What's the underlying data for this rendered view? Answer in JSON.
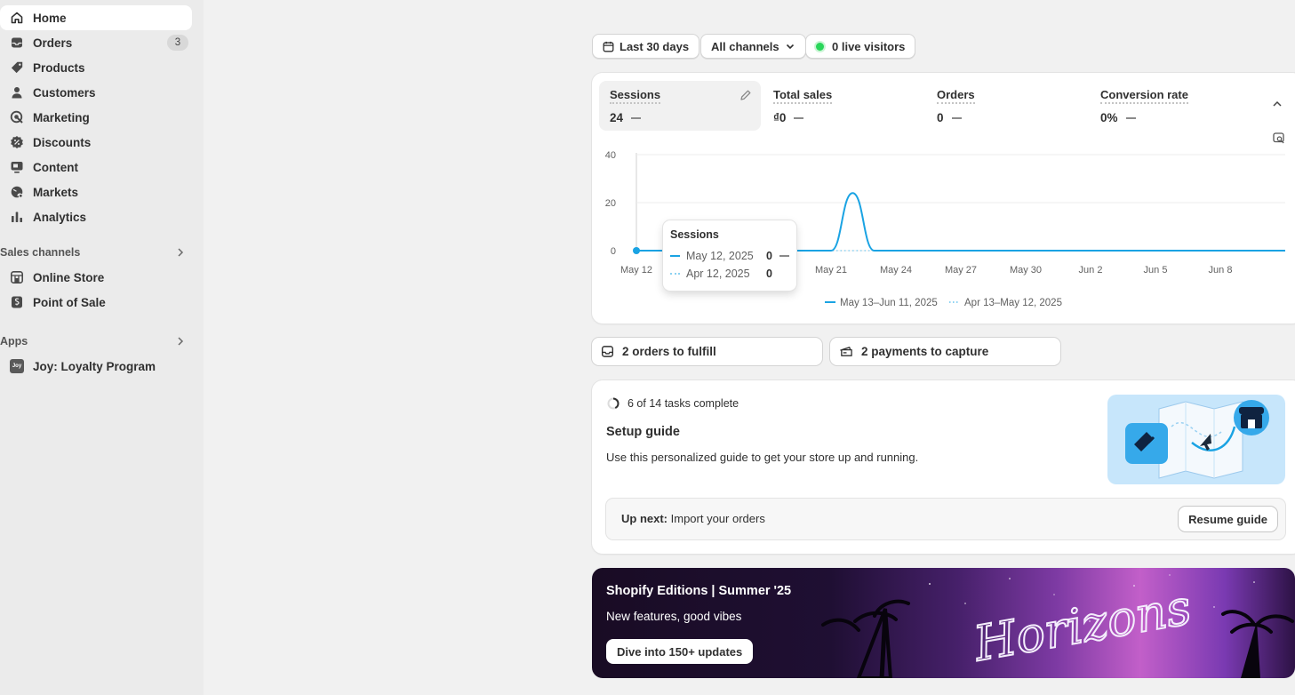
{
  "sidebar": {
    "items": [
      {
        "label": "Home",
        "icon": "home-icon"
      },
      {
        "label": "Orders",
        "icon": "orders-icon",
        "badge": "3"
      },
      {
        "label": "Products",
        "icon": "tag-icon"
      },
      {
        "label": "Customers",
        "icon": "person-icon"
      },
      {
        "label": "Marketing",
        "icon": "target-icon"
      },
      {
        "label": "Discounts",
        "icon": "discount-icon"
      },
      {
        "label": "Content",
        "icon": "content-icon"
      },
      {
        "label": "Markets",
        "icon": "globe-icon"
      },
      {
        "label": "Analytics",
        "icon": "bar-chart-icon"
      }
    ],
    "sales_channels_label": "Sales channels",
    "sales_channels": [
      {
        "label": "Online Store",
        "icon": "store-icon"
      },
      {
        "label": "Point of Sale",
        "icon": "pos-icon"
      }
    ],
    "apps_label": "Apps",
    "apps": [
      {
        "label": "Joy: Loyalty Program",
        "icon": "joy-logo",
        "logo_text": "Joy"
      }
    ]
  },
  "filters": {
    "date_range": "Last 30 days",
    "channels": "All channels",
    "live_visitors": "0 live visitors"
  },
  "metrics": [
    {
      "label": "Sessions",
      "value": "24"
    },
    {
      "label": "Total sales",
      "value": "₫0"
    },
    {
      "label": "Orders",
      "value": "0"
    },
    {
      "label": "Conversion rate",
      "value": "0%"
    }
  ],
  "chart_data": {
    "type": "line",
    "x": [
      "May 12",
      "May 13",
      "May 14",
      "May 15",
      "May 16",
      "May 17",
      "May 18",
      "May 19",
      "May 20",
      "May 21",
      "May 22",
      "May 23",
      "May 24",
      "May 25",
      "May 26",
      "May 27",
      "May 28",
      "May 29",
      "May 30",
      "May 31",
      "Jun 1",
      "Jun 2",
      "Jun 3",
      "Jun 4",
      "Jun 5",
      "Jun 6",
      "Jun 7",
      "Jun 8",
      "Jun 9",
      "Jun 10",
      "Jun 11"
    ],
    "tick_labels": [
      "May 12",
      "May 21",
      "May 24",
      "May 27",
      "May 30",
      "Jun 2",
      "Jun 5",
      "Jun 8"
    ],
    "series": [
      {
        "name": "May 13–Jun 11, 2025",
        "style": "solid",
        "color": "#1aa3e3",
        "values": [
          0,
          0,
          0,
          0,
          0,
          0,
          0,
          0,
          0,
          0,
          24,
          0,
          0,
          0,
          0,
          0,
          0,
          0,
          0,
          0,
          0,
          0,
          0,
          0,
          0,
          0,
          0,
          0,
          0,
          0,
          0
        ]
      },
      {
        "name": "Apr 13–May 12, 2025",
        "style": "dotted",
        "color": "#8cd2f2",
        "values": [
          0,
          0,
          0,
          0,
          0,
          0,
          0,
          0,
          0,
          0,
          0,
          0,
          0,
          0,
          0,
          0,
          0,
          0,
          0,
          0,
          0,
          0,
          0,
          0,
          0,
          0,
          0,
          0,
          0,
          0,
          0
        ]
      }
    ],
    "y_ticks": [
      "0",
      "20",
      "40"
    ],
    "ylim": [
      0,
      40
    ],
    "grid": true,
    "legend": "bottom-center",
    "tooltip": {
      "title": "Sessions",
      "rows": [
        {
          "label": "May 12, 2025",
          "value": "0"
        },
        {
          "label": "Apr 12, 2025",
          "value": "0"
        }
      ]
    }
  },
  "actions": {
    "orders_to_fulfill": "2 orders to fulfill",
    "payments_to_capture": "2 payments to capture"
  },
  "setup_guide": {
    "progress_text": "6 of 14 tasks complete",
    "progress": 0.43,
    "title": "Setup guide",
    "description": "Use this personalized guide to get your store up and running.",
    "up_next_label": "Up next:",
    "up_next_task": "Import your orders",
    "resume_label": "Resume guide"
  },
  "banner": {
    "title": "Shopify Editions | Summer '25",
    "subtitle": "New features, good vibes",
    "button": "Dive into 150+ updates",
    "artwork_text": "Horizons"
  }
}
